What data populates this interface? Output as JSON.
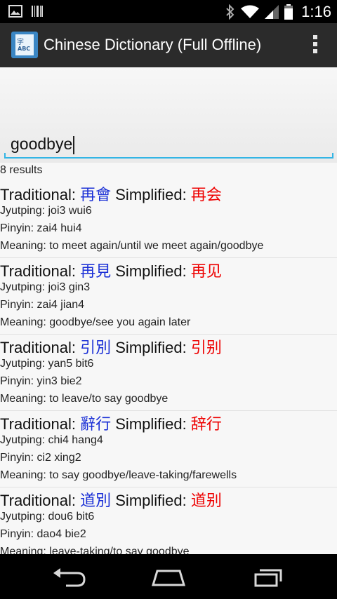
{
  "status_bar": {
    "time": "1:16",
    "icons": [
      "gallery-icon",
      "barcode-icon",
      "bluetooth-icon",
      "wifi-icon",
      "signal-icon",
      "battery-icon"
    ]
  },
  "app_bar": {
    "title": "Chinese Dictionary (Full Offline)",
    "icon": "dictionary-app-icon",
    "menu_icon": "overflow-menu-icon"
  },
  "search": {
    "value": "goodbye",
    "accent_color": "#33b5e5"
  },
  "results": {
    "count_text": "8 results",
    "label_traditional": "Traditional: ",
    "label_simplified": " Simplified: ",
    "label_jyutping": "Jyutping: ",
    "label_pinyin": "Pinyin: ",
    "label_meaning": "Meaning: ",
    "items": [
      {
        "traditional": "再會",
        "simplified": "再会",
        "jyutping": "joi3 wui6",
        "pinyin": "zai4 hui4",
        "meaning": "to meet again/until we meet again/goodbye"
      },
      {
        "traditional": "再見",
        "simplified": "再见",
        "jyutping": "joi3 gin3",
        "pinyin": "zai4 jian4",
        "meaning": "goodbye/see you again later"
      },
      {
        "traditional": "引別",
        "simplified": "引别",
        "jyutping": "yan5 bit6",
        "pinyin": "yin3 bie2",
        "meaning": "to leave/to say goodbye"
      },
      {
        "traditional": "辭行",
        "simplified": "辞行",
        "jyutping": "chi4 hang4",
        "pinyin": "ci2 xing2",
        "meaning": "to say goodbye/leave-taking/farewells"
      },
      {
        "traditional": "道別",
        "simplified": "道别",
        "jyutping": "dou6 bit6",
        "pinyin": "dao4 bie2",
        "meaning": "leave-taking/to say goodbye"
      }
    ],
    "traditional_color": "#1a2fd6",
    "simplified_color": "#ee0000"
  },
  "nav_bar": {
    "buttons": [
      "back-icon",
      "home-icon",
      "recents-icon"
    ]
  }
}
